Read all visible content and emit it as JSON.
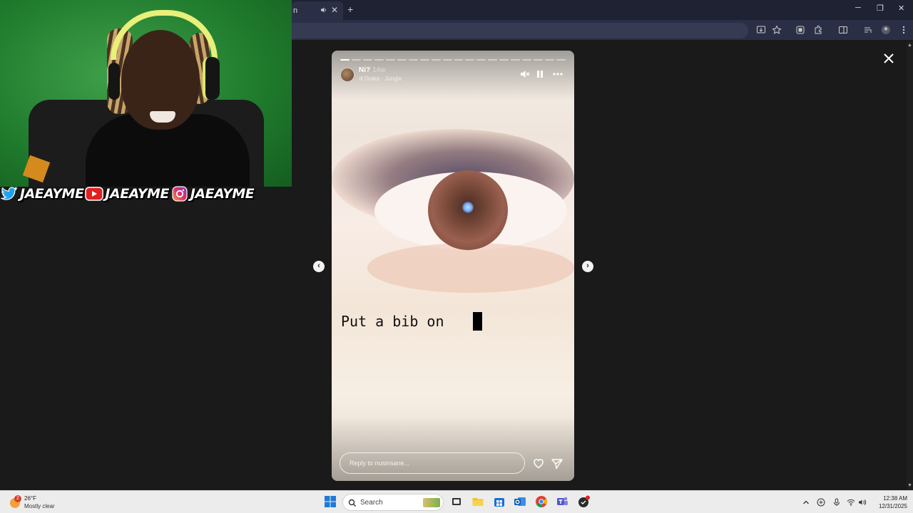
{
  "overlay": {
    "socials": [
      {
        "platform": "twitter",
        "icon": "twitter-bird-icon",
        "handle": "JAEAYME"
      },
      {
        "platform": "youtube",
        "icon": "youtube-play-icon",
        "handle": "JAEAYME"
      },
      {
        "platform": "instagram",
        "icon": "instagram-icon",
        "handle": "JAEAYME"
      }
    ]
  },
  "browser": {
    "tab": {
      "title": "n",
      "audio_icon": "speaker-icon",
      "close_icon": "close-icon"
    },
    "new_tab": "+",
    "window_controls": {
      "minimize": "─",
      "restore": "❐",
      "close": "✕"
    }
  },
  "story": {
    "segments_total": 20,
    "segments_done": 1,
    "username": "Ni?",
    "time_ago": "14w",
    "music": "Drake · Jungle",
    "text": "Put a bib on",
    "reply_placeholder": "Reply to nusinsane...",
    "controls": {
      "mute_icon": "muted-speaker-icon",
      "pause_icon": "pause-icon",
      "more_icon": "more-horizontal-icon"
    },
    "prev": "‹",
    "next": "›"
  },
  "taskbar": {
    "weather": {
      "badge": "2",
      "temp": "26°F",
      "condition": "Mostly clear"
    },
    "search_label": "Search",
    "clock": {
      "time": "12:38 AM",
      "date": "12/31/2025"
    }
  },
  "colors": {
    "browser_bg": "#1f2233",
    "page_bg": "#1a1a1a",
    "taskbar_bg": "#ececec",
    "webcam_green": "#1f7a2c"
  }
}
